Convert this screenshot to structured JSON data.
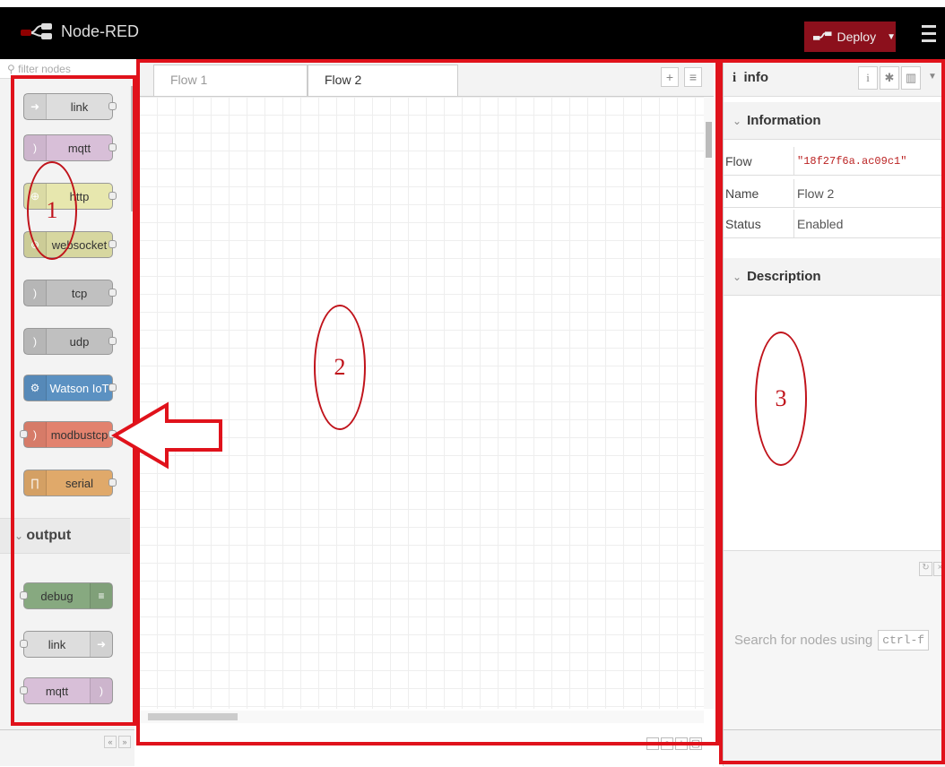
{
  "header": {
    "app_name": "Node-RED",
    "deploy_label": "Deploy"
  },
  "palette": {
    "filter_placeholder": "filter nodes",
    "nodes": [
      {
        "label": "link",
        "color": "#dddddd"
      },
      {
        "label": "mqtt",
        "color": "#d8bfd8"
      },
      {
        "label": "http",
        "color": "#e7e7ae"
      },
      {
        "label": "websocket",
        "color": "#d7d7a0"
      },
      {
        "label": "tcp",
        "color": "#c0c0c0"
      },
      {
        "label": "udp",
        "color": "#c0c0c0"
      },
      {
        "label": "Watson IoT",
        "color": "#5b91c2"
      },
      {
        "label": "modbustcp",
        "color": "#e2826e"
      },
      {
        "label": "serial",
        "color": "#e0a96a"
      }
    ],
    "category_output": "output",
    "output_nodes": [
      {
        "label": "debug",
        "color": "#87a980"
      },
      {
        "label": "link",
        "color": "#dddddd"
      },
      {
        "label": "mqtt",
        "color": "#d8bfd8"
      }
    ]
  },
  "workspace": {
    "tabs": [
      {
        "label": "Flow 1"
      },
      {
        "label": "Flow 2"
      }
    ],
    "add_tab": "+",
    "tab_menu": "≡"
  },
  "sidebar": {
    "title": "info",
    "section_information": "Information",
    "rows": [
      {
        "key": "Flow",
        "value": "\"18f27f6a.ac09c1\""
      },
      {
        "key": "Name",
        "value": "Flow 2"
      },
      {
        "key": "Status",
        "value": "Enabled"
      }
    ],
    "section_description": "Description",
    "help_text": "Search for nodes using",
    "help_shortcut": "ctrl-f"
  },
  "annotations": {
    "one": "1",
    "two": "2",
    "three": "3",
    "box_color": "#e0121b"
  }
}
